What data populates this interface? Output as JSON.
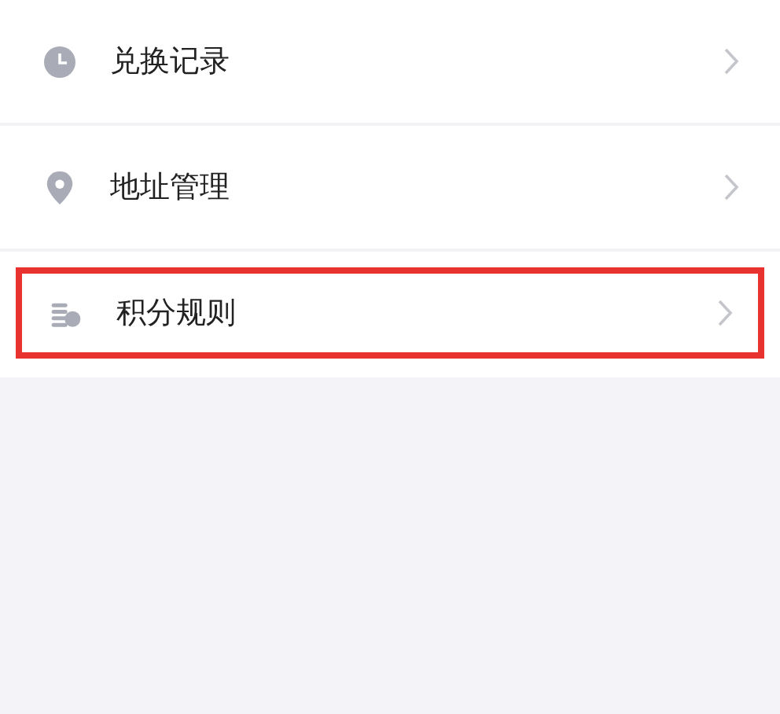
{
  "menu": [
    {
      "label": "兑换记录",
      "highlighted": false
    },
    {
      "label": "地址管理",
      "highlighted": false
    },
    {
      "label": "积分规则",
      "highlighted": true
    }
  ]
}
